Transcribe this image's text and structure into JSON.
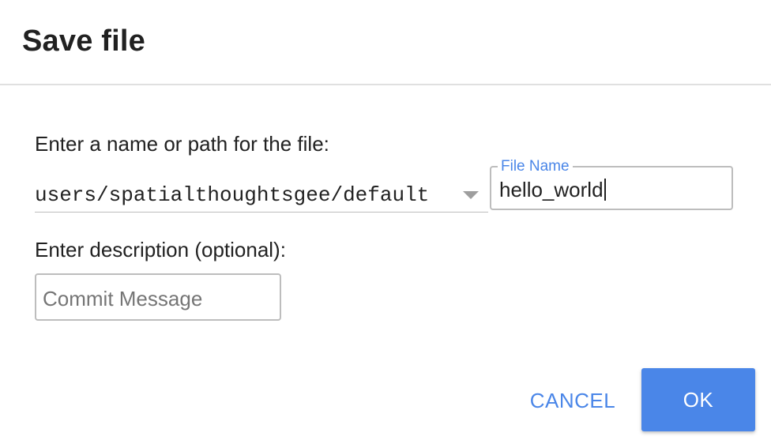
{
  "dialog": {
    "title": "Save file",
    "path_label": "Enter a name or path for the file:",
    "path_value": "users/spatialthoughtsgee/default",
    "file_name": {
      "label": "File Name",
      "value": "hello_world"
    },
    "description_label": "Enter description (optional):",
    "commit_message": {
      "placeholder": "Commit Message",
      "value": ""
    },
    "buttons": {
      "cancel": "CANCEL",
      "ok": "OK"
    }
  },
  "colors": {
    "accent": "#4a86e8",
    "border": "#bdbdbd",
    "text": "#212121",
    "placeholder": "#757575"
  },
  "icons": {
    "path_dropdown": "caret-down-icon"
  }
}
